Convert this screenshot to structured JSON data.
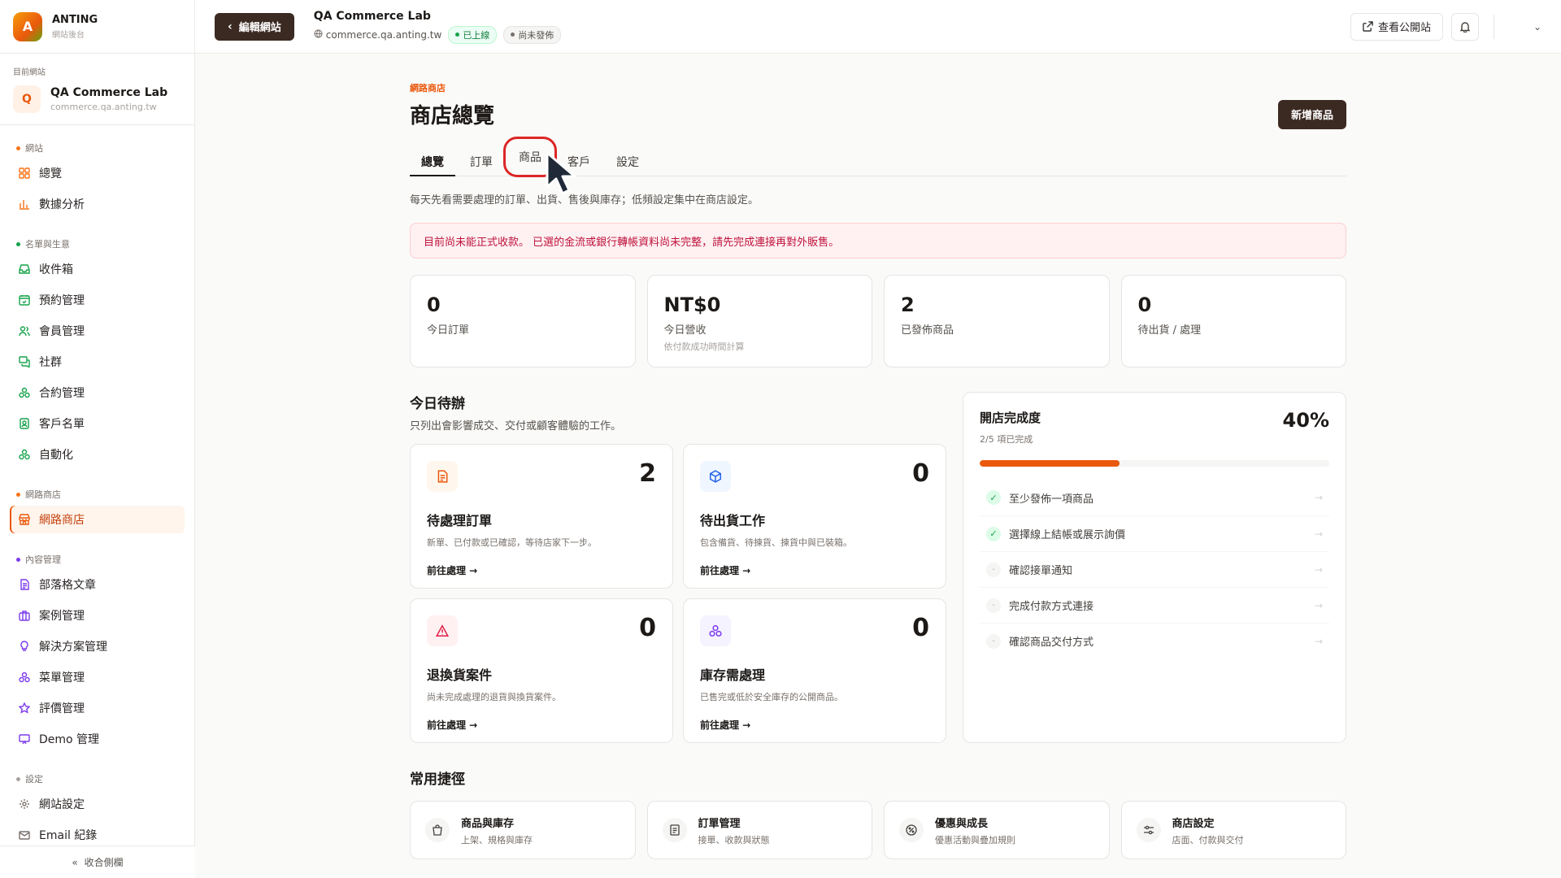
{
  "brand": {
    "name": "ANTING",
    "sub": "網站後台",
    "initial": "A"
  },
  "current_site": {
    "label": "目前網站",
    "initial": "Q",
    "name": "QA Commerce Lab",
    "domain": "commerce.qa.anting.tw"
  },
  "nav": {
    "group_site": "網站",
    "overview": "總覽",
    "analytics": "數據分析",
    "group_crm": "名單與生意",
    "inbox": "收件箱",
    "booking": "預約管理",
    "members": "會員管理",
    "community": "社群",
    "contracts": "合約管理",
    "customers": "客戶名單",
    "automation": "自動化",
    "group_shop": "網路商店",
    "shop": "網路商店",
    "group_content": "內容管理",
    "blog": "部落格文章",
    "cases": "案例管理",
    "solutions": "解決方案管理",
    "menus": "菜單管理",
    "reviews": "評價管理",
    "demo": "Demo 管理",
    "group_settings": "設定",
    "site_settings": "網站設定",
    "email_log": "Email 紀錄",
    "collapse": "收合側欄"
  },
  "topbar": {
    "edit_site": "編輯網站",
    "site_title": "QA Commerce Lab",
    "site_domain": "commerce.qa.anting.tw",
    "badge_live": "已上線",
    "badge_unpublished": "尚未發佈",
    "view_public": "查看公開站"
  },
  "page": {
    "eyebrow": "網路商店",
    "title": "商店總覽",
    "add_product": "新增商品",
    "tabs": [
      "總覽",
      "訂單",
      "商品",
      "客戶",
      "設定"
    ],
    "description": "每天先看需要處理的訂單、出貨、售後與庫存；低頻設定集中在商店設定。",
    "alert": "目前尚未能正式收款。 已選的金流或銀行轉帳資料尚未完整，請先完成連接再對外販售。"
  },
  "stats": [
    {
      "value": "0",
      "label": "今日訂單",
      "note": ""
    },
    {
      "value": "NT$0",
      "label": "今日營收",
      "note": "依付款成功時間計算"
    },
    {
      "value": "2",
      "label": "已發佈商品",
      "note": ""
    },
    {
      "value": "0",
      "label": "待出貨 / 處理",
      "note": ""
    }
  ],
  "todo": {
    "title": "今日待辦",
    "subtitle": "只列出會影響成交、交付或顧客體驗的工作。",
    "go_label": "前往處理 →",
    "cards": [
      {
        "icon": "document-icon",
        "count": "2",
        "title": "待處理訂單",
        "desc": "新單、已付款或已確認，等待店家下一步。"
      },
      {
        "icon": "box-icon",
        "count": "0",
        "title": "待出貨工作",
        "desc": "包含備貨、待揀貨、揀貨中與已裝箱。"
      },
      {
        "icon": "warning-icon",
        "count": "0",
        "title": "退換貨案件",
        "desc": "尚未完成處理的退貨與換貨案件。"
      },
      {
        "icon": "boxes-icon",
        "count": "0",
        "title": "庫存需處理",
        "desc": "已售完或低於安全庫存的公開商品。"
      }
    ]
  },
  "progress": {
    "title": "開店完成度",
    "sub": "2/5 項已完成",
    "percent": "40%",
    "fraction": 0.4,
    "items": [
      {
        "label": "至少發佈一項商品",
        "done": true
      },
      {
        "label": "選擇線上結帳或展示詢價",
        "done": true
      },
      {
        "label": "確認接單通知",
        "done": false
      },
      {
        "label": "完成付款方式連接",
        "done": false
      },
      {
        "label": "確認商品交付方式",
        "done": false
      }
    ]
  },
  "shortcuts": {
    "title": "常用捷徑",
    "items": [
      {
        "icon": "bag-icon",
        "title": "商品與庫存",
        "desc": "上架、規格與庫存"
      },
      {
        "icon": "list-icon",
        "title": "訂單管理",
        "desc": "接單、收款與狀態"
      },
      {
        "icon": "percent-icon",
        "title": "優惠與成長",
        "desc": "優惠活動與疊加規則"
      },
      {
        "icon": "sliders-icon",
        "title": "商店設定",
        "desc": "店面、付款與交付"
      }
    ]
  },
  "colors": {
    "accent": "#ea580c",
    "dark": "#3b2a22",
    "alert": "#be123c"
  }
}
